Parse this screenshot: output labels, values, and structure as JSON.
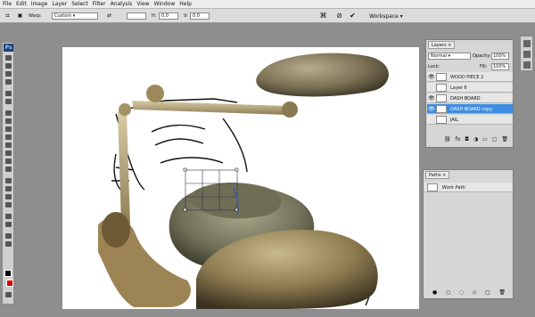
{
  "menu": [
    "File",
    "Edit",
    "Image",
    "Layer",
    "Select",
    "Filter",
    "Analysis",
    "View",
    "Window",
    "Help"
  ],
  "options": {
    "warp_label": "Warp:",
    "warp_value": "Custom",
    "h_value": "0.0",
    "v_value": "0.0",
    "workspace_label": "Workspace ▾"
  },
  "app_logo": "Ps",
  "layers_panel": {
    "tab": "Layers ×",
    "blend_mode": "Normal",
    "opacity_label": "Opacity:",
    "opacity_value": "100%",
    "lock_label": "Lock:",
    "fill_label": "Fill:",
    "fill_value": "100%",
    "rows": [
      {
        "name": "WOOD PIECE 2",
        "visible": true,
        "selected": false
      },
      {
        "name": "Layer 6",
        "visible": false,
        "selected": false
      },
      {
        "name": "DASH BOARD",
        "visible": true,
        "selected": false
      },
      {
        "name": "DASH BOARD copy",
        "visible": true,
        "selected": true
      },
      {
        "name": "JAIL",
        "visible": false,
        "selected": false
      }
    ]
  },
  "paths_panel": {
    "tab": "Paths ×",
    "rows": [
      {
        "name": "Work Path"
      }
    ]
  },
  "colors": {
    "foreground": "#000000",
    "background": "#d40000",
    "accent": "#3d8de0"
  }
}
